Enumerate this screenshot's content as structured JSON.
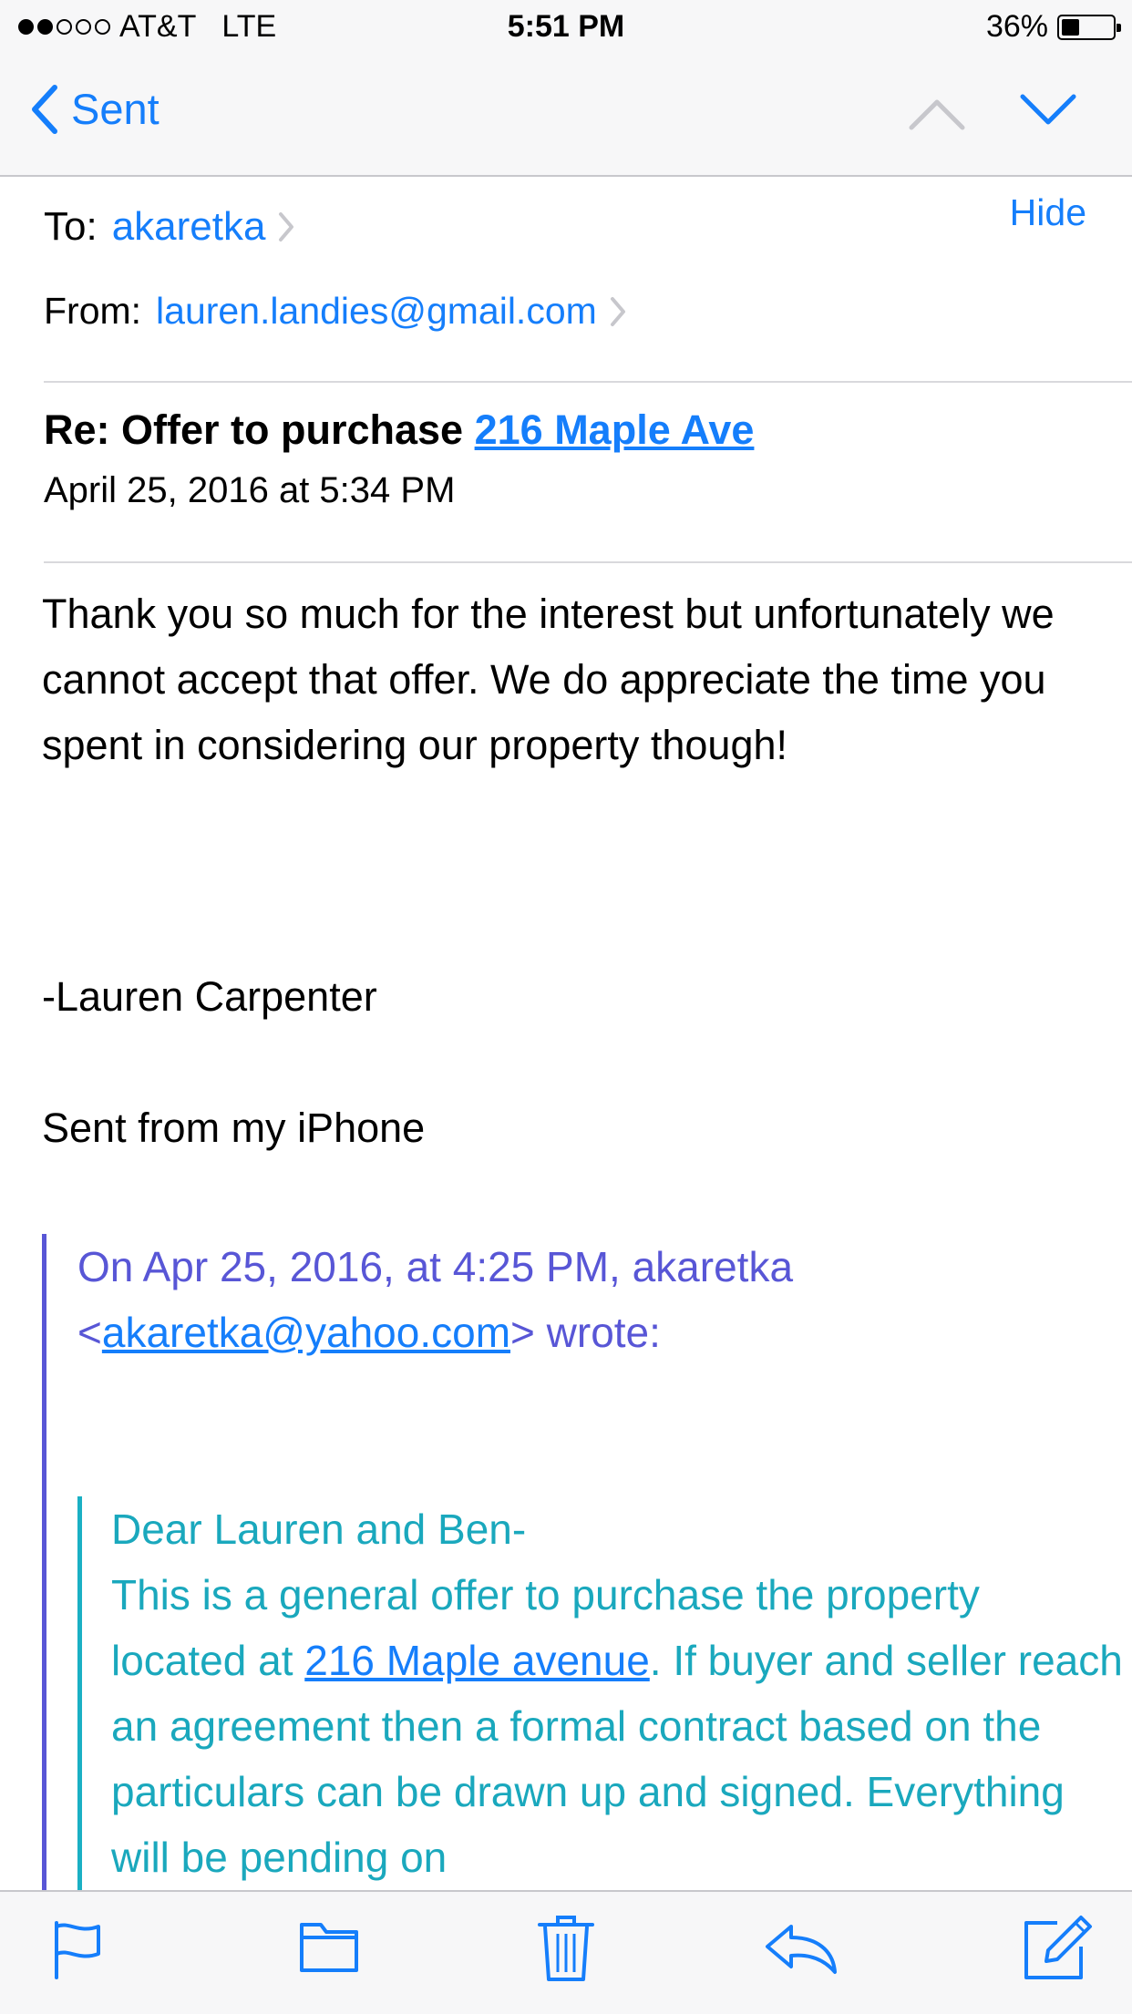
{
  "status_bar": {
    "carrier": "AT&T",
    "network": "LTE",
    "time": "5:51 PM",
    "battery": "36%",
    "battery_level": 0.36
  },
  "nav": {
    "back_label": "Sent"
  },
  "header": {
    "to_label": "To:",
    "to_value": "akaretka",
    "from_label": "From:",
    "from_value": "lauren.landies@gmail.com",
    "hide_label": "Hide"
  },
  "message": {
    "subject_prefix": "Re: Offer to purchase",
    "subject_link": "216 Maple Ave",
    "date": "April 25, 2016 at 5:34 PM",
    "body": "Thank you so much for the interest but unfortunately we cannot accept that offer.  We do appreciate the time you spent in considering our property though!",
    "signature": "-Lauren Carpenter",
    "sent_from": "Sent from my iPhone"
  },
  "quote": {
    "attribution_start": "On Apr 25, 2016, at 4:25 PM, akaretka",
    "attribution_lt": "<",
    "attribution_email": "akaretka@yahoo.com",
    "attribution_end": "> wrote:",
    "greeting": "Dear Lauren and Ben-",
    "text_before_link": "This is a general offer to purchase the property located at ",
    "link": "216 Maple avenue",
    "text_after_link": ". If buyer and seller reach an agreement then a formal contract based on the particulars can be drawn up and signed. Everything will be pending on"
  },
  "toolbar": {
    "icons": [
      "flag-icon",
      "folder-icon",
      "trash-icon",
      "reply-icon",
      "compose-icon"
    ]
  },
  "colors": {
    "accent": "#157efb",
    "quote_level1": "#5856d6",
    "quote_level2": "#1ab0c4"
  }
}
